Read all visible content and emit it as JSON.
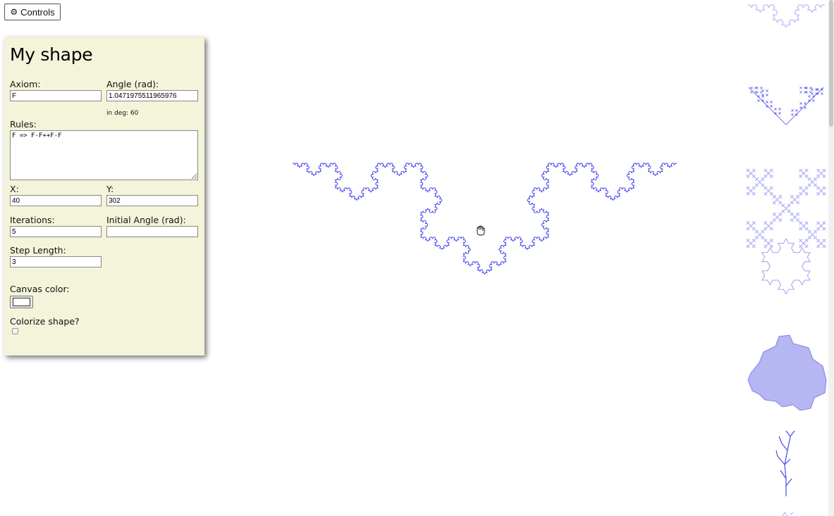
{
  "controls_button": {
    "label": "Controls",
    "icon": "gear-icon"
  },
  "panel": {
    "title": "My shape",
    "axiom": {
      "label": "Axiom:",
      "value": "F"
    },
    "angle": {
      "label": "Angle (rad):",
      "value": "1.0471975511965976",
      "deg_note": "in deg: 60"
    },
    "rules": {
      "label": "Rules:",
      "value": "F => F-F++F-F"
    },
    "x": {
      "label": "X:",
      "value": "40"
    },
    "y": {
      "label": "Y:",
      "value": "302"
    },
    "iterations": {
      "label": "Iterations:",
      "value": "5"
    },
    "initial_angle": {
      "label": "Initial Angle (rad):",
      "value": ""
    },
    "step_length": {
      "label": "Step Length:",
      "value": "3"
    },
    "canvas_color": {
      "label": "Canvas color:",
      "value": "#ffffff"
    },
    "colorize": {
      "label": "Colorize shape?",
      "checked": false
    }
  },
  "colors": {
    "stroke": "#3333ee",
    "panel_bg": "#f4f4db"
  }
}
